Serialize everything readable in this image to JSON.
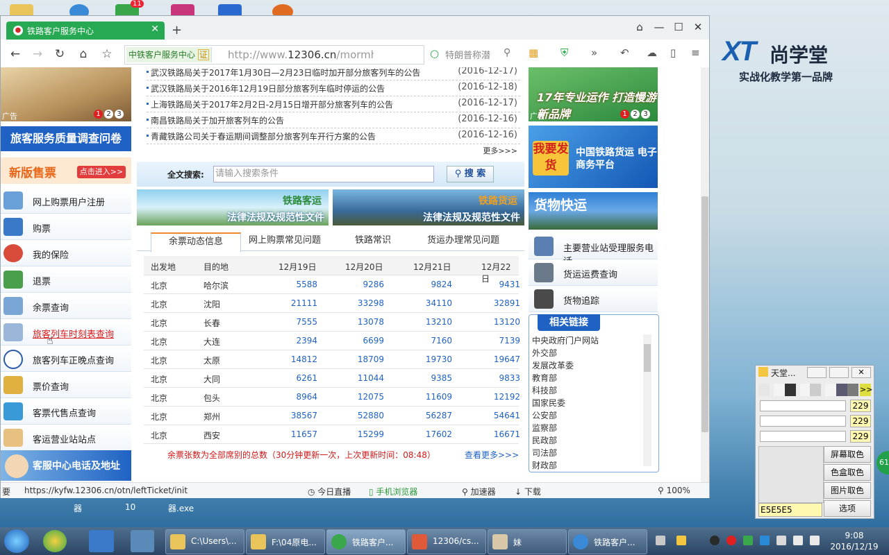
{
  "desktop": {
    "brand": {
      "logo": "XT",
      "name": "尚学堂",
      "slogan": "实战化教学第一品牌"
    },
    "labels": [
      "器",
      "10",
      "器.exe"
    ],
    "badge": "61",
    "top_badge": "11"
  },
  "browser": {
    "tab_title": "铁路客户服务中心",
    "address_site": "中铁客户服务中心",
    "address_cert": "证",
    "address_url_prefix": "http://www.",
    "address_url_domain": "12306.cn",
    "address_url_suffix": "/mormh",
    "search_hint": "特朗普称潜"
  },
  "status": {
    "url": "https://kyfw.12306.cn/otn/leftTicket/init",
    "left_partial": "要",
    "items": [
      "今日直播",
      "手机浏览器",
      "加速器",
      "下载"
    ],
    "zoom": "100%"
  },
  "left": {
    "ad_tag": "广告",
    "dots": [
      "1",
      "2",
      "3"
    ],
    "survey": "旅客服务质量调查问卷",
    "newsale_title": "新版售票",
    "newsale_btn": "点击进入>>",
    "menu": [
      "网上购票用户注册",
      "购票",
      "我的保险",
      "退票",
      "余票查询",
      "旅客列车时刻表查询",
      "旅客列车正晚点查询",
      "票价查询",
      "客票代售点查询",
      "客运营业站站点"
    ],
    "service": "客服中心电话及地址"
  },
  "news": [
    {
      "title": "武汉铁路局关于2017年1月30日—2月23日临时加开部分旅客列车的公告",
      "date": "(2016-12-17)"
    },
    {
      "title": "武汉铁路局关于2016年12月19日部分旅客列车临时停运的公告",
      "date": "(2016-12-18)"
    },
    {
      "title": "上海铁路局关于2017年2月2日-2月15日增开部分旅客列车的公告",
      "date": "(2016-12-17)"
    },
    {
      "title": "南昌铁路局关于加开旅客列车的公告",
      "date": "(2016-12-16)"
    },
    {
      "title": "青藏铁路公司关于春运期间调整部分旅客列车开行方案的公告",
      "date": "(2016-12-16)"
    }
  ],
  "news_more": "更多>>>",
  "search": {
    "label": "全文搜索:",
    "placeholder": "请输入搜索条件",
    "button": "搜 索"
  },
  "law": [
    {
      "tag": "铁路客运",
      "sub": "法律法规及规范性文件"
    },
    {
      "tag": "铁路货运",
      "sub": "法律法规及规范性文件"
    }
  ],
  "tabs": [
    "余票动态信息",
    "网上购票常见问题",
    "铁路常识",
    "货运办理常见问题"
  ],
  "table": {
    "headers": [
      "出发地",
      "目的地",
      "12月19日",
      "12月20日",
      "12月21日",
      "12月22日"
    ],
    "rows": [
      [
        "北京",
        "哈尔滨",
        "5588",
        "9286",
        "9824",
        "9431"
      ],
      [
        "北京",
        "沈阳",
        "21111",
        "33298",
        "34110",
        "32891"
      ],
      [
        "北京",
        "长春",
        "7555",
        "13078",
        "13210",
        "13120"
      ],
      [
        "北京",
        "大连",
        "2394",
        "6699",
        "7160",
        "7139"
      ],
      [
        "北京",
        "太原",
        "14812",
        "18709",
        "19730",
        "19647"
      ],
      [
        "北京",
        "大同",
        "6261",
        "11044",
        "9385",
        "9833"
      ],
      [
        "北京",
        "包头",
        "8964",
        "12075",
        "11609",
        "12192"
      ],
      [
        "北京",
        "郑州",
        "38567",
        "52880",
        "56287",
        "54641"
      ],
      [
        "北京",
        "西安",
        "11657",
        "15299",
        "17602",
        "16671"
      ]
    ],
    "note": "余票张数为全部席别的总数（30分钟更新一次，上次更新时间：08:48）",
    "more": "查看更多>>>"
  },
  "right": {
    "r1_text": "17年专业运作 打造慢游新品牌",
    "r1_tag": "广告",
    "r2_btn": "我要发货",
    "r2_text": "中国铁路货运 电子商务平台",
    "r3_text": "货物快运",
    "services": [
      "主要营业站受理服务电话",
      "货运运费查询",
      "货物追踪"
    ],
    "links_title": "相关链接",
    "links": [
      "中央政府门户网站",
      "外交部",
      "发展改革委",
      "教育部",
      "科技部",
      "国家民委",
      "公安部",
      "监察部",
      "民政部",
      "司法部",
      "财政部"
    ]
  },
  "picker": {
    "title": "天堂...",
    "values": [
      "229",
      "229",
      "229"
    ],
    "actions": [
      "屏幕取色",
      "色盒取色",
      "图片取色",
      "选项"
    ],
    "hex": "E5E5E5",
    "more": ">>"
  },
  "taskbar": {
    "tasks": [
      "C:\\Users\\...",
      "F:\\04原电...",
      "铁路客户...",
      "12306/cs...",
      "妹",
      "铁路客户..."
    ],
    "time": "9:08",
    "date": "2016/12/19"
  }
}
